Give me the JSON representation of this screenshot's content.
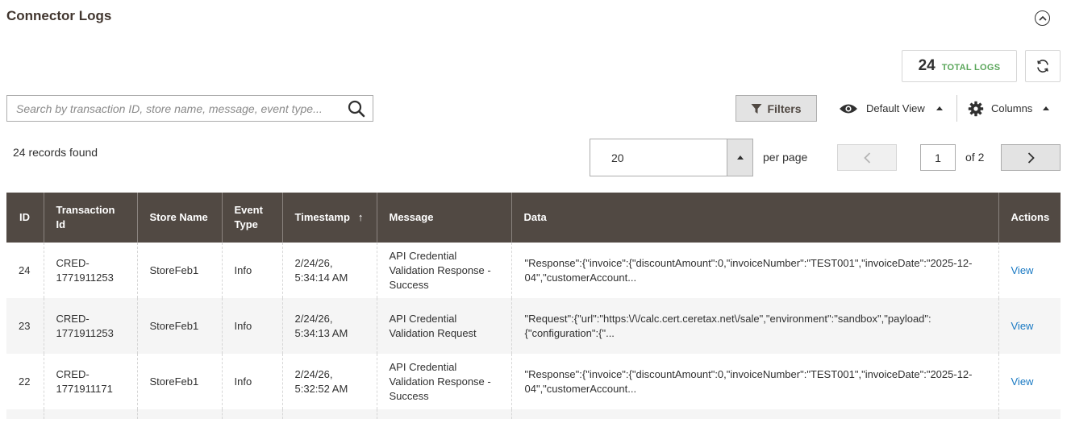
{
  "header": {
    "title": "Connector Logs"
  },
  "summary": {
    "total_count": "24",
    "total_label": "TOTAL LOGS"
  },
  "search": {
    "placeholder": "Search by transaction ID, store name, message, event type...",
    "value": ""
  },
  "toolbar": {
    "filters_label": "Filters",
    "view_label": "Default View",
    "columns_label": "Columns"
  },
  "records_found": "24 records found",
  "pagination": {
    "per_page_value": "20",
    "per_page_label": "per page",
    "current_page": "1",
    "of_pages": "of 2"
  },
  "table": {
    "columns": {
      "id": "ID",
      "transaction_id": "Transaction Id",
      "store_name": "Store Name",
      "event_type": "Event Type",
      "timestamp": "Timestamp",
      "timestamp_sort": "↑",
      "message": "Message",
      "data": "Data",
      "actions": "Actions"
    },
    "rows": [
      {
        "id": "24",
        "transaction_id": "CRED-1771911253",
        "store_name": "StoreFeb1",
        "event_type": "Info",
        "timestamp": "2/24/26, 5:34:14 AM",
        "message": "API Credential Validation Response - Success",
        "data": "\"Response\":{\"invoice\":{\"discountAmount\":0,\"invoiceNumber\":\"TEST001\",\"invoiceDate\":\"2025-12-04\",\"customerAccount...",
        "action": "View"
      },
      {
        "id": "23",
        "transaction_id": "CRED-1771911253",
        "store_name": "StoreFeb1",
        "event_type": "Info",
        "timestamp": "2/24/26, 5:34:13 AM",
        "message": "API Credential Validation Request",
        "data": "\"Request\":{\"url\":\"https:\\/\\/calc.cert.ceretax.net\\/sale\",\"environment\":\"sandbox\",\"payload\":{\"configuration\":{\"...",
        "action": "View"
      },
      {
        "id": "22",
        "transaction_id": "CRED-1771911171",
        "store_name": "StoreFeb1",
        "event_type": "Info",
        "timestamp": "2/24/26, 5:32:52 AM",
        "message": "API Credential Validation Response - Success",
        "data": "\"Response\":{\"invoice\":{\"discountAmount\":0,\"invoiceNumber\":\"TEST001\",\"invoiceDate\":\"2025-12-04\",\"customerAccount...",
        "action": "View"
      }
    ]
  },
  "icons": {
    "collapse": "chevron-up-circle-icon",
    "refresh": "refresh-icon",
    "search": "search-icon",
    "filter": "funnel-icon",
    "view": "eye-icon",
    "columns": "gear-icon"
  },
  "colors": {
    "table_header_bg": "#514943",
    "total_label": "#5aa65a",
    "link": "#1979c3"
  }
}
